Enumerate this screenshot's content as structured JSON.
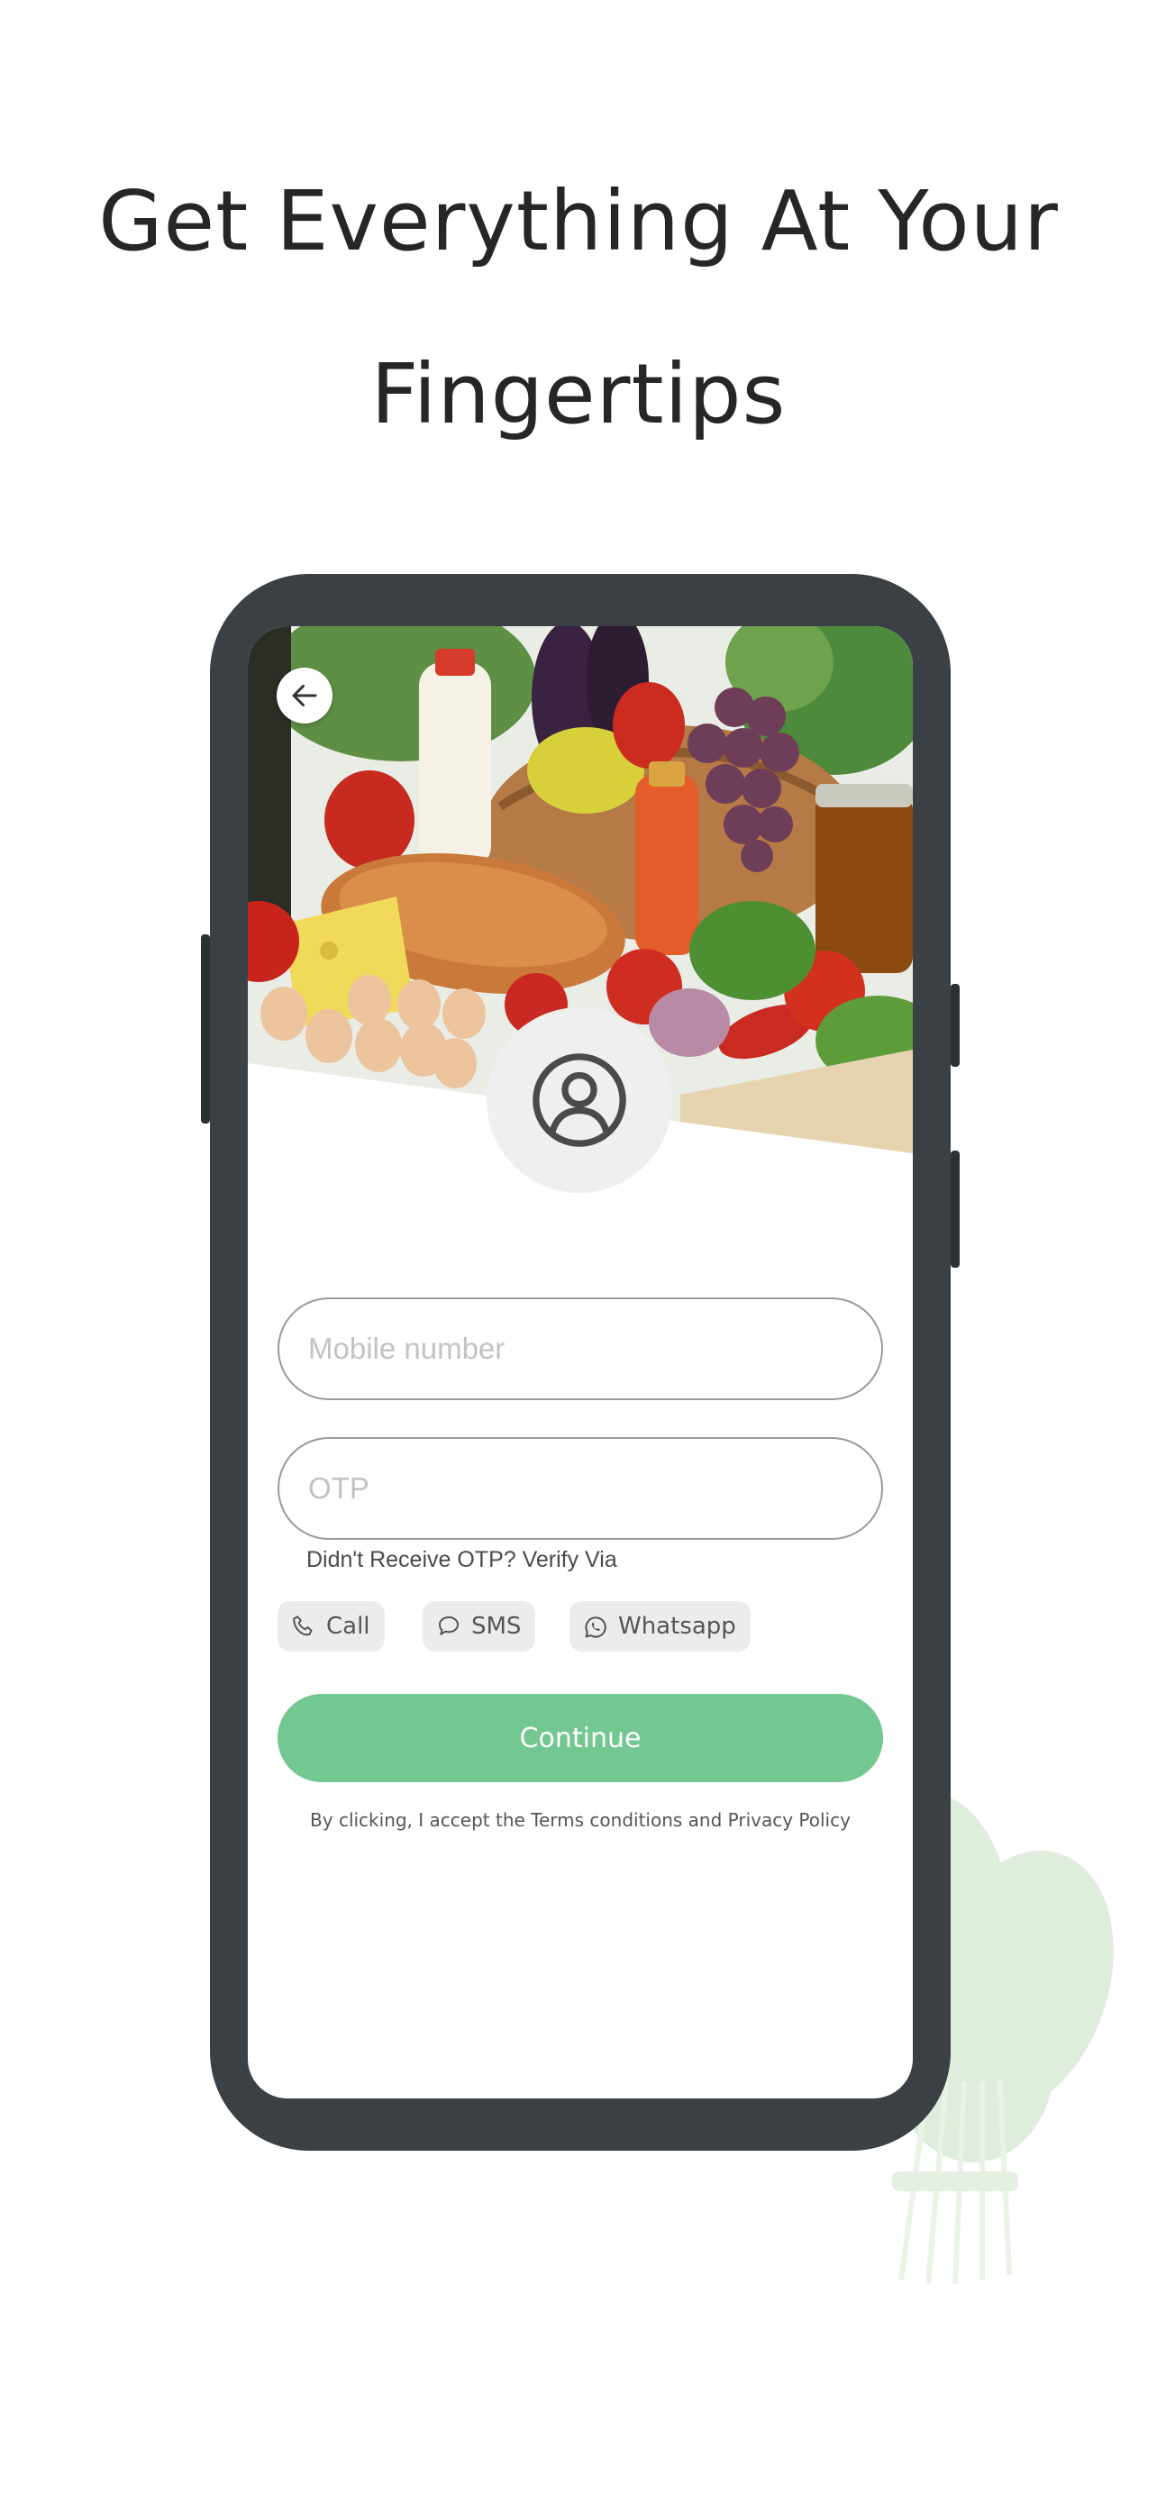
{
  "headline": {
    "line1": "Get Everything At Your",
    "line2": "Fingertips"
  },
  "screen": {
    "back_icon": "arrow-left-icon",
    "avatar_icon": "user-circle-icon",
    "mobile_placeholder": "Mobile number",
    "otp_placeholder": "OTP",
    "helper_text": "Didn't Receive OTP? Verify Via",
    "verify_options": [
      {
        "label": "Call",
        "icon": "phone-icon"
      },
      {
        "label": "SMS",
        "icon": "chat-bubble-icon"
      },
      {
        "label": "Whatsapp",
        "icon": "whatsapp-icon"
      }
    ],
    "continue_label": "Continue",
    "terms_text": "By clicking, I accept the Terms conditions and Privacy Policy"
  },
  "colors": {
    "primary": "#73c790",
    "phone_frame": "#3a4044",
    "headline": "#262626",
    "chip_bg": "#ececec"
  }
}
